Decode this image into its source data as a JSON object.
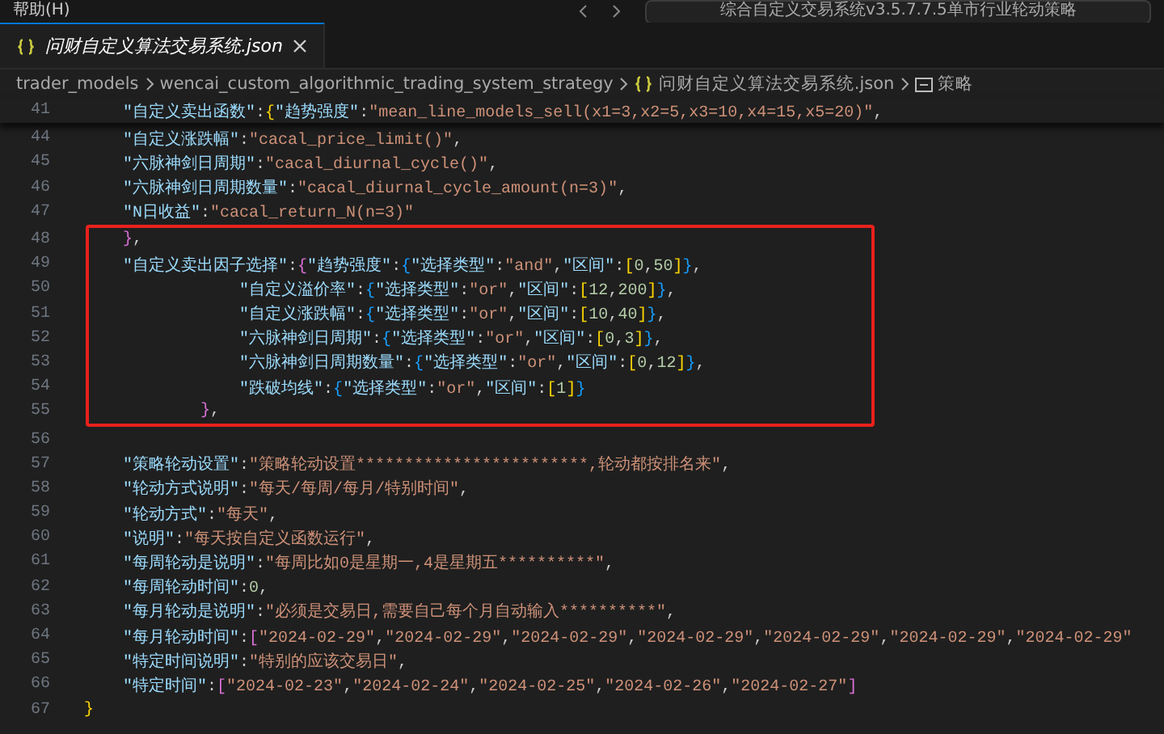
{
  "title_bar": {
    "menu": "帮助(H)",
    "command_center": "综合自定义交易系统v3.5.7.7.5单市行业轮动策略"
  },
  "tabs": [
    {
      "label": "问财自定义算法交易系统.json",
      "selected": true
    }
  ],
  "breadcrumb": [
    {
      "kind": "folder",
      "text": "trader_models"
    },
    {
      "kind": "folder",
      "text": "wencai_custom_algorithmic_trading_system_strategy"
    },
    {
      "kind": "json",
      "text": "问财自定义算法交易系统.json"
    },
    {
      "kind": "symbol",
      "text": "策略"
    }
  ],
  "editor": {
    "sticky_line": {
      "number": "41",
      "tokens": [
        {
          "kind": "key",
          "text": "    \"自定义卖出函数\""
        },
        {
          "kind": "punct",
          "text": ":"
        },
        {
          "kind": "bracket1",
          "text": "{"
        },
        {
          "kind": "key",
          "text": "\"趋势强度\""
        },
        {
          "kind": "punct",
          "text": ":"
        },
        {
          "kind": "string",
          "text": "\"mean_line_models_sell(x1=3,x2=5,x3=10,x4=15,x5=20)\""
        },
        {
          "kind": "punct",
          "text": ","
        }
      ]
    },
    "blocks": [
      {
        "kind": "plain",
        "lines": [
          {
            "number": "44",
            "tokens": [
              {
                "kind": "key",
                "text": "    \"自定义涨跌幅\""
              },
              {
                "kind": "punct",
                "text": ":"
              },
              {
                "kind": "string",
                "text": "\"cacal_price_limit()\""
              },
              {
                "kind": "punct",
                "text": ","
              }
            ]
          },
          {
            "number": "45",
            "tokens": [
              {
                "kind": "key",
                "text": "    \"六脉神剑日周期\""
              },
              {
                "kind": "punct",
                "text": ":"
              },
              {
                "kind": "string",
                "text": "\"cacal_diurnal_cycle()\""
              },
              {
                "kind": "punct",
                "text": ","
              }
            ]
          },
          {
            "number": "46",
            "tokens": [
              {
                "kind": "key",
                "text": "    \"六脉神剑日周期数量\""
              },
              {
                "kind": "punct",
                "text": ":"
              },
              {
                "kind": "string",
                "text": "\"cacal_diurnal_cycle_amount(n=3)\""
              },
              {
                "kind": "punct",
                "text": ","
              }
            ]
          },
          {
            "number": "47",
            "tokens": [
              {
                "kind": "key",
                "text": "    \"N日收益\""
              },
              {
                "kind": "punct",
                "text": ":"
              },
              {
                "kind": "string",
                "text": "\"cacal_return_N(n=3)\""
              }
            ]
          }
        ]
      },
      {
        "kind": "highlight",
        "lines": [
          {
            "number": "48",
            "tokens": [
              {
                "kind": "bracket2",
                "text": "    }"
              },
              {
                "kind": "punct",
                "text": ","
              }
            ]
          },
          {
            "number": "49",
            "tokens": [
              {
                "kind": "key",
                "text": "    \"自定义卖出因子选择\""
              },
              {
                "kind": "punct",
                "text": ":"
              },
              {
                "kind": "bracket2",
                "text": "{"
              },
              {
                "kind": "key",
                "text": "\"趋势强度\""
              },
              {
                "kind": "punct",
                "text": ":"
              },
              {
                "kind": "bracket3",
                "text": "{"
              },
              {
                "kind": "key",
                "text": "\"选择类型\""
              },
              {
                "kind": "punct",
                "text": ":"
              },
              {
                "kind": "string",
                "text": "\"and\""
              },
              {
                "kind": "punct",
                "text": ","
              },
              {
                "kind": "key",
                "text": "\"区间\""
              },
              {
                "kind": "punct",
                "text": ":"
              },
              {
                "kind": "bracket1",
                "text": "["
              },
              {
                "kind": "number",
                "text": "0"
              },
              {
                "kind": "punct",
                "text": ","
              },
              {
                "kind": "number",
                "text": "50"
              },
              {
                "kind": "bracket1",
                "text": "]"
              },
              {
                "kind": "bracket3",
                "text": "}"
              },
              {
                "kind": "punct",
                "text": ","
              }
            ]
          },
          {
            "number": "50",
            "tokens": [
              {
                "kind": "key",
                "text": "                \"自定义溢价率\""
              },
              {
                "kind": "punct",
                "text": ":"
              },
              {
                "kind": "bracket3",
                "text": "{"
              },
              {
                "kind": "key",
                "text": "\"选择类型\""
              },
              {
                "kind": "punct",
                "text": ":"
              },
              {
                "kind": "string",
                "text": "\"or\""
              },
              {
                "kind": "punct",
                "text": ","
              },
              {
                "kind": "key",
                "text": "\"区间\""
              },
              {
                "kind": "punct",
                "text": ":"
              },
              {
                "kind": "bracket1",
                "text": "["
              },
              {
                "kind": "number",
                "text": "12"
              },
              {
                "kind": "punct",
                "text": ","
              },
              {
                "kind": "number",
                "text": "200"
              },
              {
                "kind": "bracket1",
                "text": "]"
              },
              {
                "kind": "bracket3",
                "text": "}"
              },
              {
                "kind": "punct",
                "text": ","
              }
            ]
          },
          {
            "number": "51",
            "tokens": [
              {
                "kind": "key",
                "text": "                \"自定义涨跌幅\""
              },
              {
                "kind": "punct",
                "text": ":"
              },
              {
                "kind": "bracket3",
                "text": "{"
              },
              {
                "kind": "key",
                "text": "\"选择类型\""
              },
              {
                "kind": "punct",
                "text": ":"
              },
              {
                "kind": "string",
                "text": "\"or\""
              },
              {
                "kind": "punct",
                "text": ","
              },
              {
                "kind": "key",
                "text": "\"区间\""
              },
              {
                "kind": "punct",
                "text": ":"
              },
              {
                "kind": "bracket1",
                "text": "["
              },
              {
                "kind": "number",
                "text": "10"
              },
              {
                "kind": "punct",
                "text": ","
              },
              {
                "kind": "number",
                "text": "40"
              },
              {
                "kind": "bracket1",
                "text": "]"
              },
              {
                "kind": "bracket3",
                "text": "}"
              },
              {
                "kind": "punct",
                "text": ","
              }
            ]
          },
          {
            "number": "52",
            "tokens": [
              {
                "kind": "key",
                "text": "                \"六脉神剑日周期\""
              },
              {
                "kind": "punct",
                "text": ":"
              },
              {
                "kind": "bracket3",
                "text": "{"
              },
              {
                "kind": "key",
                "text": "\"选择类型\""
              },
              {
                "kind": "punct",
                "text": ":"
              },
              {
                "kind": "string",
                "text": "\"or\""
              },
              {
                "kind": "punct",
                "text": ","
              },
              {
                "kind": "key",
                "text": "\"区间\""
              },
              {
                "kind": "punct",
                "text": ":"
              },
              {
                "kind": "bracket1",
                "text": "["
              },
              {
                "kind": "number",
                "text": "0"
              },
              {
                "kind": "punct",
                "text": ","
              },
              {
                "kind": "number",
                "text": "3"
              },
              {
                "kind": "bracket1",
                "text": "]"
              },
              {
                "kind": "bracket3",
                "text": "}"
              },
              {
                "kind": "punct",
                "text": ","
              }
            ]
          },
          {
            "number": "53",
            "tokens": [
              {
                "kind": "key",
                "text": "                \"六脉神剑日周期数量\""
              },
              {
                "kind": "punct",
                "text": ":"
              },
              {
                "kind": "bracket3",
                "text": "{"
              },
              {
                "kind": "key",
                "text": "\"选择类型\""
              },
              {
                "kind": "punct",
                "text": ":"
              },
              {
                "kind": "string",
                "text": "\"or\""
              },
              {
                "kind": "punct",
                "text": ","
              },
              {
                "kind": "key",
                "text": "\"区间\""
              },
              {
                "kind": "punct",
                "text": ":"
              },
              {
                "kind": "bracket1",
                "text": "["
              },
              {
                "kind": "number",
                "text": "0"
              },
              {
                "kind": "punct",
                "text": ","
              },
              {
                "kind": "number",
                "text": "12"
              },
              {
                "kind": "bracket1",
                "text": "]"
              },
              {
                "kind": "bracket3",
                "text": "}"
              },
              {
                "kind": "punct",
                "text": ","
              }
            ]
          },
          {
            "number": "54",
            "tokens": [
              {
                "kind": "key",
                "text": "                \"跌破均线\""
              },
              {
                "kind": "punct",
                "text": ":"
              },
              {
                "kind": "bracket3",
                "text": "{"
              },
              {
                "kind": "key",
                "text": "\"选择类型\""
              },
              {
                "kind": "punct",
                "text": ":"
              },
              {
                "kind": "string",
                "text": "\"or\""
              },
              {
                "kind": "punct",
                "text": ","
              },
              {
                "kind": "key",
                "text": "\"区间\""
              },
              {
                "kind": "punct",
                "text": ":"
              },
              {
                "kind": "bracket1",
                "text": "["
              },
              {
                "kind": "number",
                "text": "1"
              },
              {
                "kind": "bracket1",
                "text": "]"
              },
              {
                "kind": "bracket3",
                "text": "}"
              }
            ]
          },
          {
            "number": "55",
            "tokens": [
              {
                "kind": "bracket2",
                "text": "            }"
              },
              {
                "kind": "punct",
                "text": ","
              }
            ]
          }
        ]
      },
      {
        "kind": "plain",
        "lines": [
          {
            "number": "56"
          },
          {
            "number": "57",
            "tokens": [
              {
                "kind": "key",
                "text": "    \"策略轮动设置\""
              },
              {
                "kind": "punct",
                "text": ":"
              },
              {
                "kind": "string",
                "text": "\"策略轮动设置************************,轮动都按排名来\""
              },
              {
                "kind": "punct",
                "text": ","
              }
            ]
          },
          {
            "number": "58",
            "tokens": [
              {
                "kind": "key",
                "text": "    \"轮动方式说明\""
              },
              {
                "kind": "punct",
                "text": ":"
              },
              {
                "kind": "string",
                "text": "\"每天/每周/每月/特别时间\""
              },
              {
                "kind": "punct",
                "text": ","
              }
            ]
          },
          {
            "number": "59",
            "tokens": [
              {
                "kind": "key",
                "text": "    \"轮动方式\""
              },
              {
                "kind": "punct",
                "text": ":"
              },
              {
                "kind": "string",
                "text": "\"每天\""
              },
              {
                "kind": "punct",
                "text": ","
              }
            ]
          },
          {
            "number": "60",
            "tokens": [
              {
                "kind": "key",
                "text": "    \"说明\""
              },
              {
                "kind": "punct",
                "text": ":"
              },
              {
                "kind": "string",
                "text": "\"每天按自定义函数运行\""
              },
              {
                "kind": "punct",
                "text": ","
              }
            ]
          },
          {
            "number": "61",
            "tokens": [
              {
                "kind": "key",
                "text": "    \"每周轮动是说明\""
              },
              {
                "kind": "punct",
                "text": ":"
              },
              {
                "kind": "string",
                "text": "\"每周比如0是星期一,4是星期五**********\""
              },
              {
                "kind": "punct",
                "text": ","
              }
            ]
          },
          {
            "number": "62",
            "tokens": [
              {
                "kind": "key",
                "text": "    \"每周轮动时间\""
              },
              {
                "kind": "punct",
                "text": ":"
              },
              {
                "kind": "number",
                "text": "0"
              },
              {
                "kind": "punct",
                "text": ","
              }
            ]
          },
          {
            "number": "63",
            "tokens": [
              {
                "kind": "key",
                "text": "    \"每月轮动是说明\""
              },
              {
                "kind": "punct",
                "text": ":"
              },
              {
                "kind": "string",
                "text": "\"必须是交易日,需要自己每个月自动输入**********\""
              },
              {
                "kind": "punct",
                "text": ","
              }
            ]
          },
          {
            "number": "64",
            "tokens": [
              {
                "kind": "key",
                "text": "    \"每月轮动时间\""
              },
              {
                "kind": "punct",
                "text": ":"
              },
              {
                "kind": "bracket2",
                "text": "["
              },
              {
                "kind": "string",
                "text": "\"2024-02-29\""
              },
              {
                "kind": "punct",
                "text": ","
              },
              {
                "kind": "string",
                "text": "\"2024-02-29\""
              },
              {
                "kind": "punct",
                "text": ","
              },
              {
                "kind": "string",
                "text": "\"2024-02-29\""
              },
              {
                "kind": "punct",
                "text": ","
              },
              {
                "kind": "string",
                "text": "\"2024-02-29\""
              },
              {
                "kind": "punct",
                "text": ","
              },
              {
                "kind": "string",
                "text": "\"2024-02-29\""
              },
              {
                "kind": "punct",
                "text": ","
              },
              {
                "kind": "string",
                "text": "\"2024-02-29\""
              },
              {
                "kind": "punct",
                "text": ","
              },
              {
                "kind": "string",
                "text": "\"2024-02-29\""
              }
            ]
          },
          {
            "number": "65",
            "tokens": [
              {
                "kind": "key",
                "text": "    \"特定时间说明\""
              },
              {
                "kind": "punct",
                "text": ":"
              },
              {
                "kind": "string",
                "text": "\"特别的应该交易日\""
              },
              {
                "kind": "punct",
                "text": ","
              }
            ]
          },
          {
            "number": "66",
            "tokens": [
              {
                "kind": "key",
                "text": "    \"特定时间\""
              },
              {
                "kind": "punct",
                "text": ":"
              },
              {
                "kind": "bracket2",
                "text": "["
              },
              {
                "kind": "string",
                "text": "\"2024-02-23\""
              },
              {
                "kind": "punct",
                "text": ","
              },
              {
                "kind": "string",
                "text": "\"2024-02-24\""
              },
              {
                "kind": "punct",
                "text": ","
              },
              {
                "kind": "string",
                "text": "\"2024-02-25\""
              },
              {
                "kind": "punct",
                "text": ","
              },
              {
                "kind": "string",
                "text": "\"2024-02-26\""
              },
              {
                "kind": "punct",
                "text": ","
              },
              {
                "kind": "string",
                "text": "\"2024-02-27\""
              },
              {
                "kind": "bracket2",
                "text": "]"
              }
            ]
          },
          {
            "number": "67",
            "tokens": [
              {
                "kind": "bracket1",
                "text": "}"
              }
            ]
          }
        ]
      }
    ]
  }
}
